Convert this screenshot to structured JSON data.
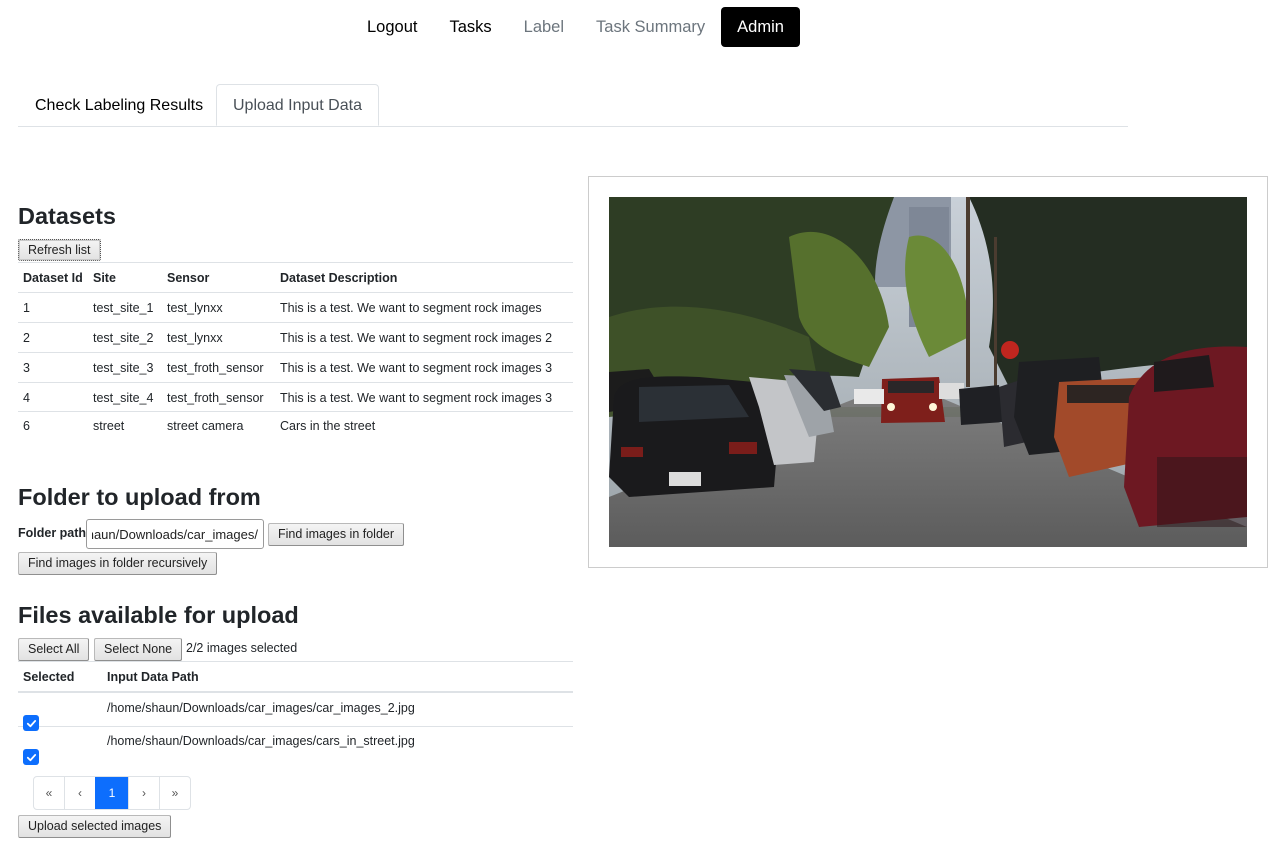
{
  "nav": {
    "items": [
      {
        "label": "Logout",
        "state": "normal"
      },
      {
        "label": "Tasks",
        "state": "normal"
      },
      {
        "label": "Label",
        "state": "muted"
      },
      {
        "label": "Task Summary",
        "state": "muted"
      },
      {
        "label": "Admin",
        "state": "active"
      }
    ]
  },
  "tabs": [
    {
      "label": "Check Labeling Results",
      "active": false
    },
    {
      "label": "Upload Input Data",
      "active": true
    }
  ],
  "datasets": {
    "title": "Datasets",
    "refresh_label": "Refresh list",
    "columns": [
      "Dataset Id",
      "Site",
      "Sensor",
      "Dataset Description"
    ],
    "rows": [
      [
        "1",
        "test_site_1",
        "test_lynxx",
        "This is a test. We want to segment rock images"
      ],
      [
        "2",
        "test_site_2",
        "test_lynxx",
        "This is a test. We want to segment rock images 2"
      ],
      [
        "3",
        "test_site_3",
        "test_froth_sensor",
        "This is a test. We want to segment rock images 3"
      ],
      [
        "4",
        "test_site_4",
        "test_froth_sensor",
        "This is a test. We want to segment rock images 3"
      ],
      [
        "6",
        "street",
        "street camera",
        "Cars in the street"
      ]
    ]
  },
  "folder": {
    "title": "Folder to upload from",
    "path_label": "Folder path",
    "path_value": "/home/shaun/Downloads/car_images/",
    "find_label": "Find images in folder",
    "find_recursive_label": "Find images in folder recursively"
  },
  "files": {
    "title": "Files available for upload",
    "select_all_label": "Select All",
    "select_none_label": "Select None",
    "status": "2/2 images selected",
    "columns": [
      "Selected",
      "Input Data Path"
    ],
    "rows": [
      {
        "selected": true,
        "path": "/home/shaun/Downloads/car_images/car_images_2.jpg"
      },
      {
        "selected": true,
        "path": "/home/shaun/Downloads/car_images/cars_in_street.jpg"
      }
    ],
    "pagination": {
      "first": "«",
      "prev": "‹",
      "current": "1",
      "next": "›",
      "last": "»"
    },
    "upload_label": "Upload selected images"
  },
  "colors": {
    "accent": "#0d6efd",
    "nav_active_bg": "#000000",
    "muted": "#6c757d"
  }
}
